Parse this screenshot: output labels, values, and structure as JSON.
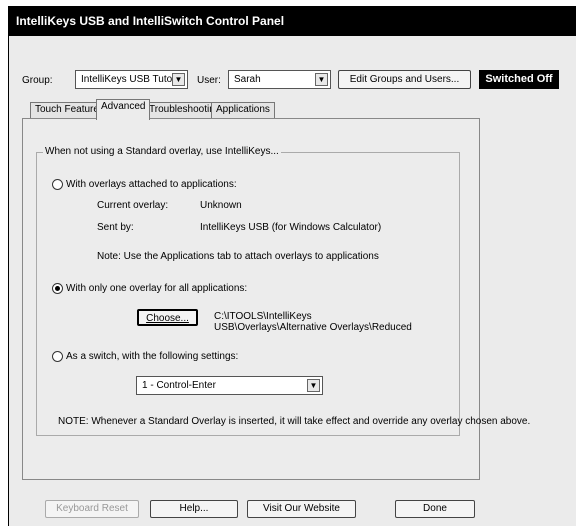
{
  "window": {
    "title": "IntelliKeys USB and IntelliSwitch Control Panel"
  },
  "header": {
    "group_label": "Group:",
    "group_value": "IntelliKeys USB Tutorial",
    "user_label": "User:",
    "user_value": "Sarah",
    "edit_button": "Edit Groups and Users...",
    "status": "Switched Off"
  },
  "tabs": [
    {
      "label": "Touch Features"
    },
    {
      "label": "Advanced"
    },
    {
      "label": "Troubleshooting"
    },
    {
      "label": "Applications"
    }
  ],
  "advanced": {
    "group_legend": "When not using a Standard overlay, use IntelliKeys...",
    "option1": {
      "label": "With overlays attached to applications:",
      "current_overlay_label": "Current overlay:",
      "current_overlay_value": "Unknown",
      "sent_by_label": "Sent by:",
      "sent_by_value": "IntelliKeys USB (for Windows Calculator)",
      "note": "Note: Use the Applications tab to attach overlays to applications"
    },
    "option2": {
      "label": "With only one overlay for all applications:",
      "choose_button": "Choose...",
      "path": "C:\\ITOOLS\\IntelliKeys USB\\Overlays\\Alternative Overlays\\Reduced Alphabet Overlay\\Sandkeyboard"
    },
    "option3": {
      "label": "As a switch, with the following settings:",
      "switch_setting": "1 - Control-Enter"
    },
    "footer_note": "NOTE: Whenever a Standard Overlay is inserted, it will take effect and override any overlay chosen above.",
    "selected_option": 2
  },
  "bottom_buttons": {
    "keyboard_reset": "Keyboard Reset",
    "help": "Help...",
    "website": "Visit Our Website",
    "done": "Done"
  }
}
